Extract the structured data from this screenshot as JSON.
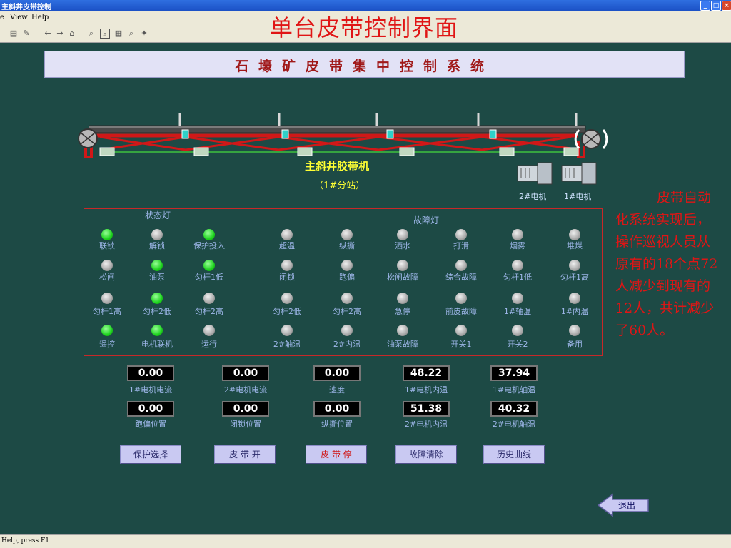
{
  "window": {
    "title": "主斜井皮带控制",
    "controls": [
      "_",
      "□",
      "×"
    ]
  },
  "menu": [
    {
      "label": "e"
    },
    {
      "label": "View"
    },
    {
      "label": "Help"
    }
  ],
  "toolbar_icons": [
    "print-icon",
    "tools-icon",
    "back-icon",
    "forward-icon",
    "home-icon",
    "zoom-icon",
    "select-icon",
    "grid-icon",
    "zoom-out-icon",
    "pin-icon"
  ],
  "slide_title": "单台皮带控制界面",
  "system_title": "石壕矿皮带集中控制系统",
  "conveyor": {
    "name": "主斜井胶带机",
    "station": "（1#分站）",
    "motors": [
      "2#电机",
      "1#电机"
    ],
    "colors": {
      "frame": "#d01818",
      "belt": "#4a4a4a",
      "rail": "#3fc23f",
      "support": "#d8d8d8"
    }
  },
  "status_lamps": {
    "title": "状态灯",
    "items": [
      {
        "label": "联锁",
        "on": true
      },
      {
        "label": "解锁",
        "on": false
      },
      {
        "label": "保护投入",
        "on": true
      },
      {
        "label": "松闸",
        "on": false
      },
      {
        "label": "油泵",
        "on": true
      },
      {
        "label": "匀杆1低",
        "on": true
      },
      {
        "label": "匀杆1高",
        "on": false
      },
      {
        "label": "匀杆2低",
        "on": true
      },
      {
        "label": "匀杆2高",
        "on": false
      },
      {
        "label": "遥控",
        "on": true
      },
      {
        "label": "电机联机",
        "on": true
      },
      {
        "label": "运行",
        "on": false
      }
    ]
  },
  "fault_lamps": {
    "title": "故障灯",
    "items": [
      {
        "label": "超温",
        "on": false
      },
      {
        "label": "纵撕",
        "on": false
      },
      {
        "label": "洒水",
        "on": false
      },
      {
        "label": "打滑",
        "on": false
      },
      {
        "label": "烟雾",
        "on": false
      },
      {
        "label": "堆煤",
        "on": false
      },
      {
        "label": "闭锁",
        "on": false
      },
      {
        "label": "跑偏",
        "on": false
      },
      {
        "label": "松闸故障",
        "on": false
      },
      {
        "label": "综合故障",
        "on": false
      },
      {
        "label": "匀杆1低",
        "on": false
      },
      {
        "label": "匀杆1高",
        "on": false
      },
      {
        "label": "匀杆2低",
        "on": false
      },
      {
        "label": "匀杆2高",
        "on": false
      },
      {
        "label": "急停",
        "on": false
      },
      {
        "label": "前皮故障",
        "on": false
      },
      {
        "label": "1#轴温",
        "on": false
      },
      {
        "label": "1#内温",
        "on": false
      },
      {
        "label": "2#轴温",
        "on": false
      },
      {
        "label": "2#内温",
        "on": false
      },
      {
        "label": "油泵故障",
        "on": false
      },
      {
        "label": "开关1",
        "on": false
      },
      {
        "label": "开关2",
        "on": false
      },
      {
        "label": "备用",
        "on": false
      }
    ]
  },
  "readouts": [
    {
      "value": "0.00",
      "label": "1#电机电流"
    },
    {
      "value": "0.00",
      "label": "2#电机电流"
    },
    {
      "value": "0.00",
      "label": "速度"
    },
    {
      "value": "48.22",
      "label": "1#电机内温"
    },
    {
      "value": "37.94",
      "label": "1#电机轴温"
    },
    {
      "value": "0.00",
      "label": "跑偏位置"
    },
    {
      "value": "0.00",
      "label": "闭锁位置"
    },
    {
      "value": "0.00",
      "label": "纵撕位置"
    },
    {
      "value": "51.38",
      "label": "2#电机内温"
    },
    {
      "value": "40.32",
      "label": "2#电机轴温"
    }
  ],
  "buttons": [
    {
      "label": "保护选择"
    },
    {
      "label": "皮 带 开"
    },
    {
      "label": "皮 带 停"
    },
    {
      "label": "故障清除"
    },
    {
      "label": "历史曲线"
    }
  ],
  "exit_label": "退出",
  "note": "皮带自动化系统实现后，操作巡视人员从原有的18个点72人减少到现有的12人，共计减少了60人。",
  "status_bar": "Help, press F1",
  "colors": {
    "background": "#1d4a45",
    "lamp_on": "#1ed21e",
    "lamp_off": "#a8a8a8",
    "accent_red": "#e01515",
    "label_blue": "#9db6e8",
    "belt_name_yellow": "#ffff33"
  }
}
